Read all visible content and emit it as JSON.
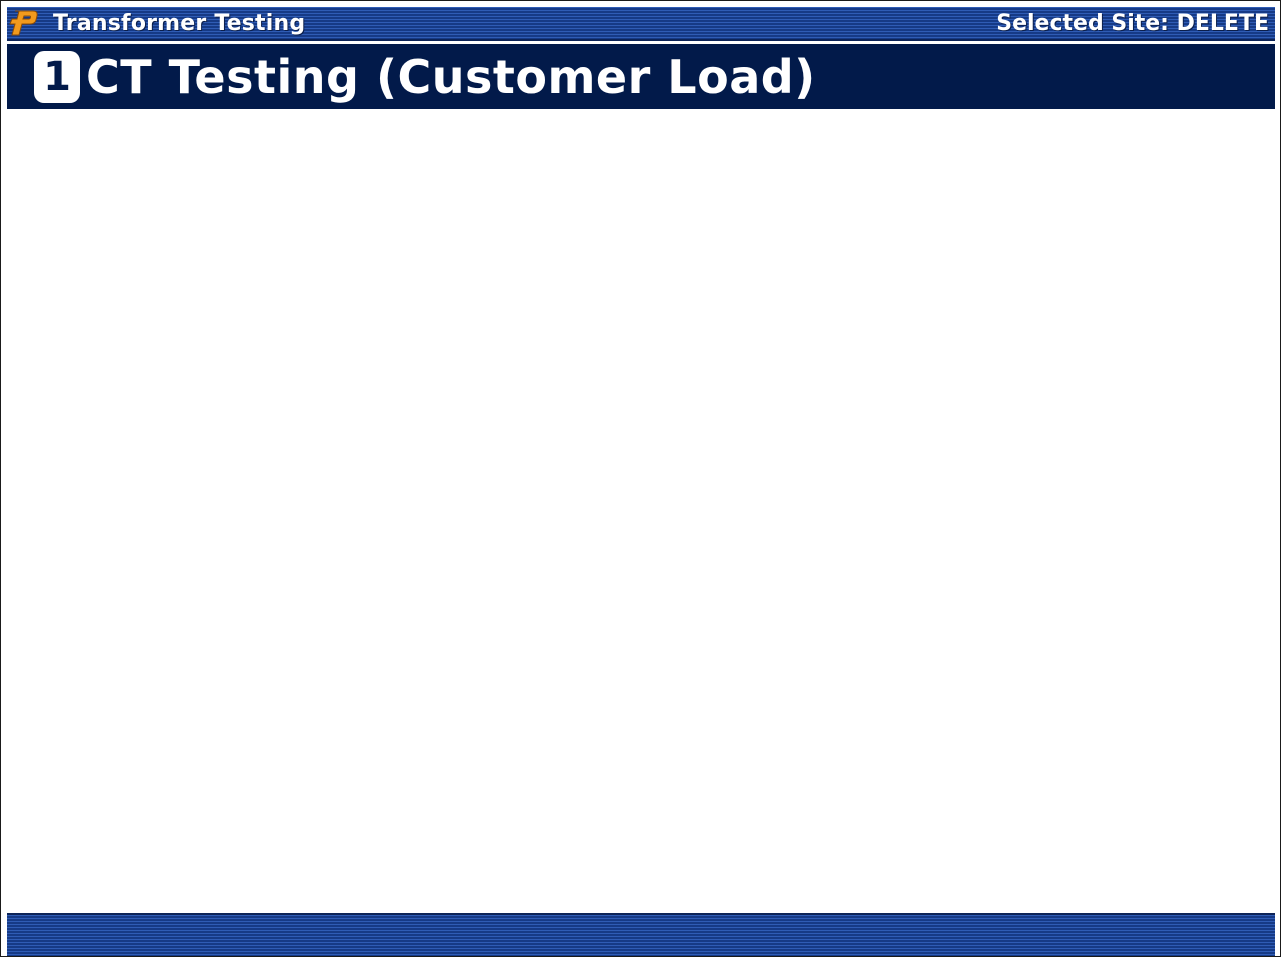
{
  "titlebar": {
    "logo_icon": "p-logo-icon",
    "app_title": "Transformer Testing",
    "site_label": "Selected Site: DELETE"
  },
  "header": {
    "step_number": "1",
    "heading": "CT Testing (Customer Load)"
  },
  "colors": {
    "titlebar_blue": "#1b3f8c",
    "header_navy": "#021a4a",
    "logo_orange": "#f29a1d",
    "background": "#ffffff"
  }
}
